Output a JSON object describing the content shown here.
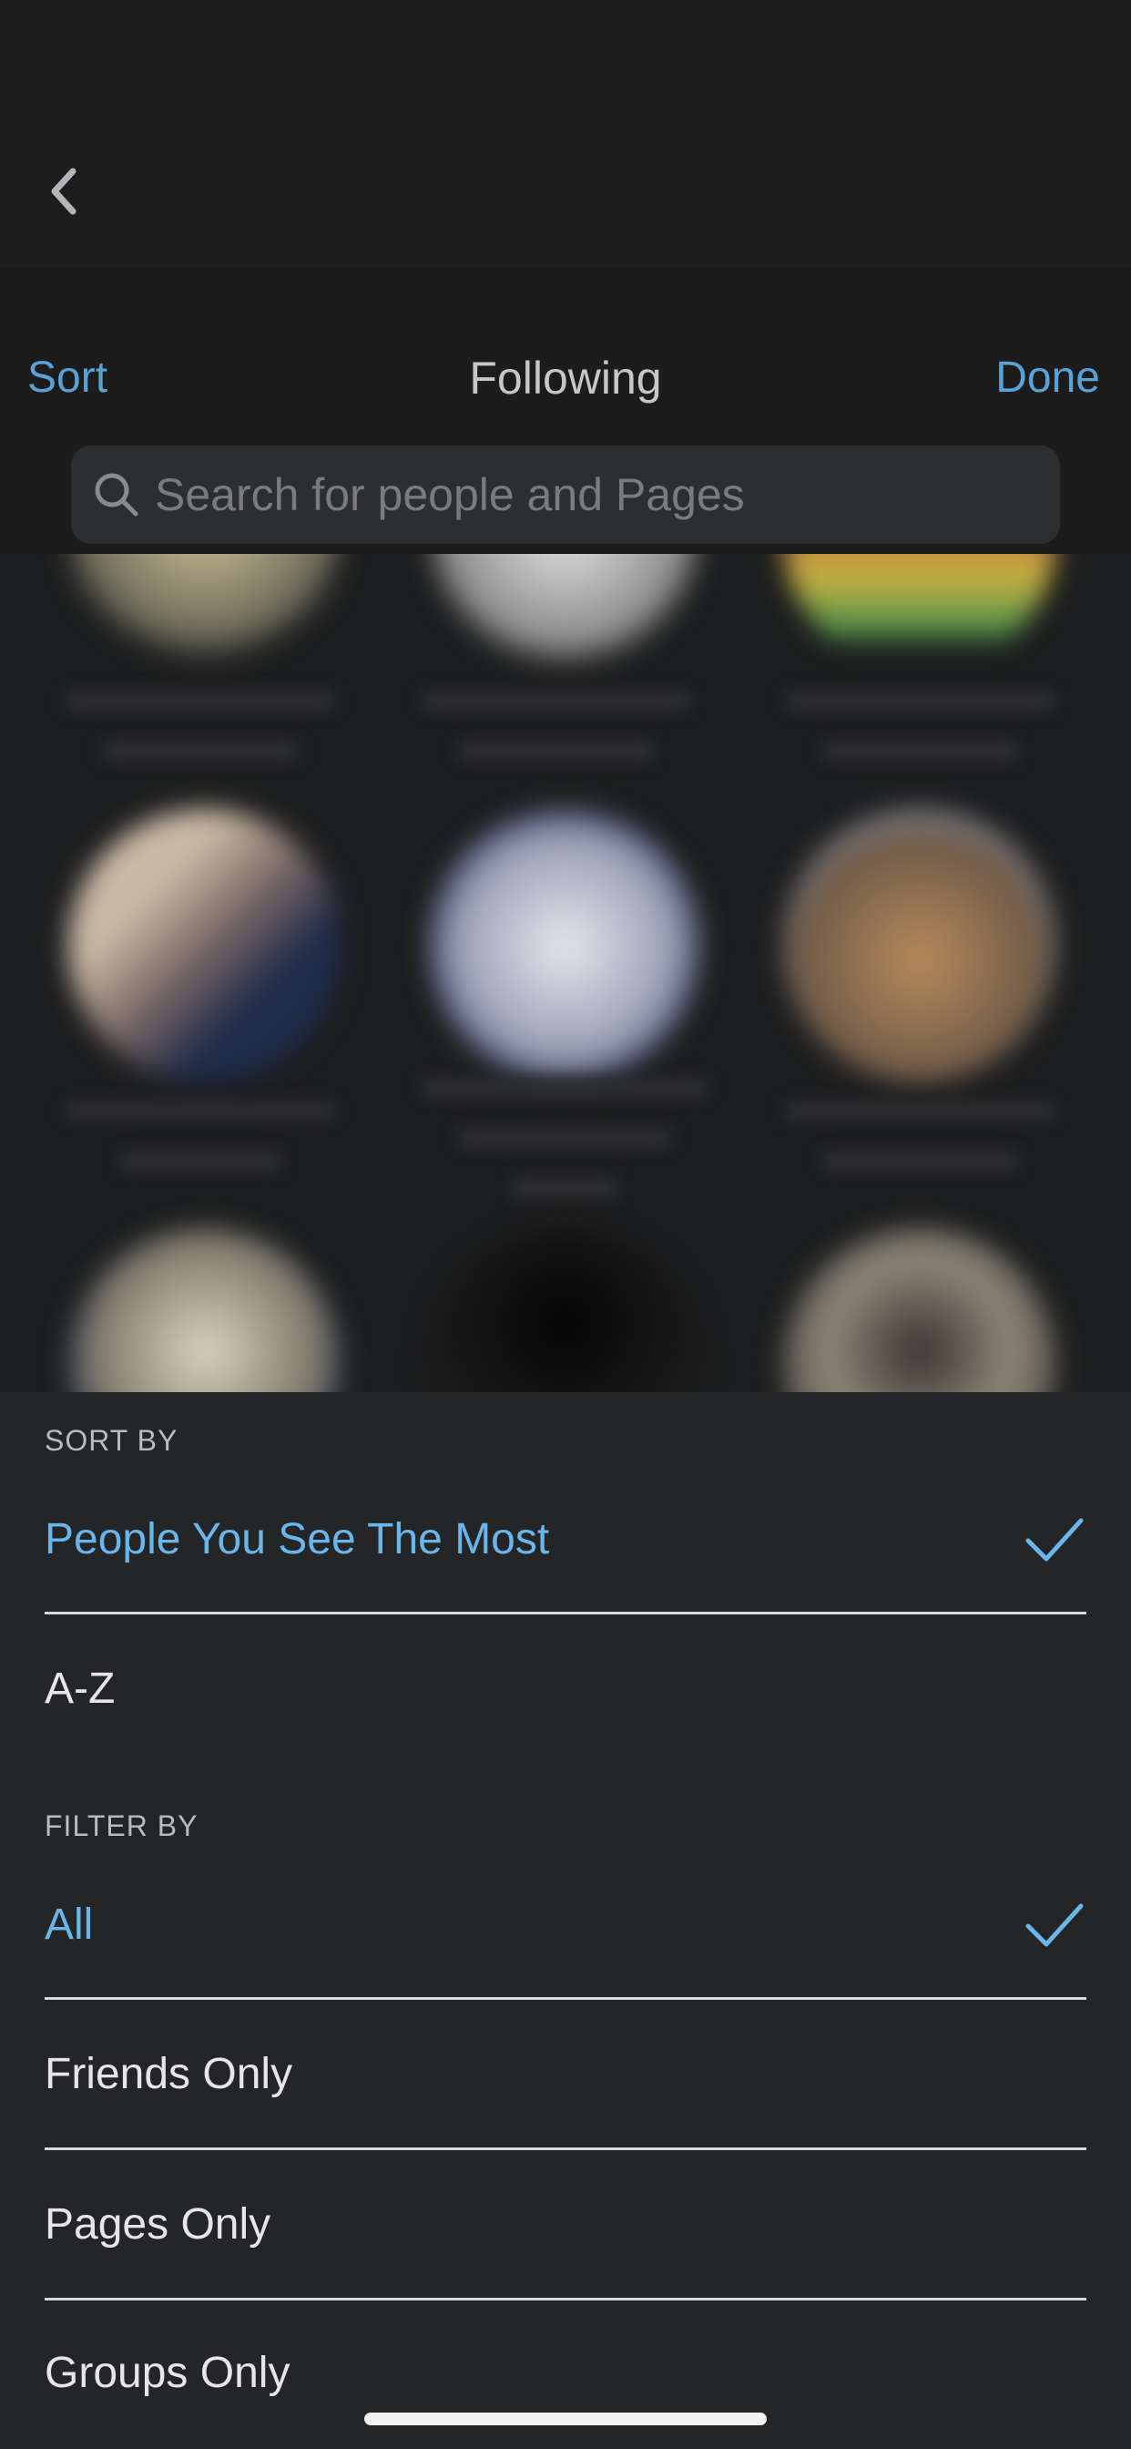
{
  "header": {
    "sort_label": "Sort",
    "title": "Following",
    "done_label": "Done"
  },
  "search": {
    "placeholder": "Search for people and Pages"
  },
  "sheet": {
    "sort_section": {
      "label": "SORT BY",
      "options": [
        {
          "label": "People You See The Most",
          "selected": true
        },
        {
          "label": "A-Z",
          "selected": false
        }
      ]
    },
    "filter_section": {
      "label": "FILTER BY",
      "options": [
        {
          "label": "All",
          "selected": true
        },
        {
          "label": "Friends Only",
          "selected": false
        },
        {
          "label": "Pages Only",
          "selected": false
        },
        {
          "label": "Groups Only",
          "selected": false
        }
      ]
    }
  },
  "colors": {
    "accent": "#5aa2d5",
    "selected_option": "#6ab6eb",
    "background": "#1c1c1d",
    "sheet": "#232526"
  }
}
